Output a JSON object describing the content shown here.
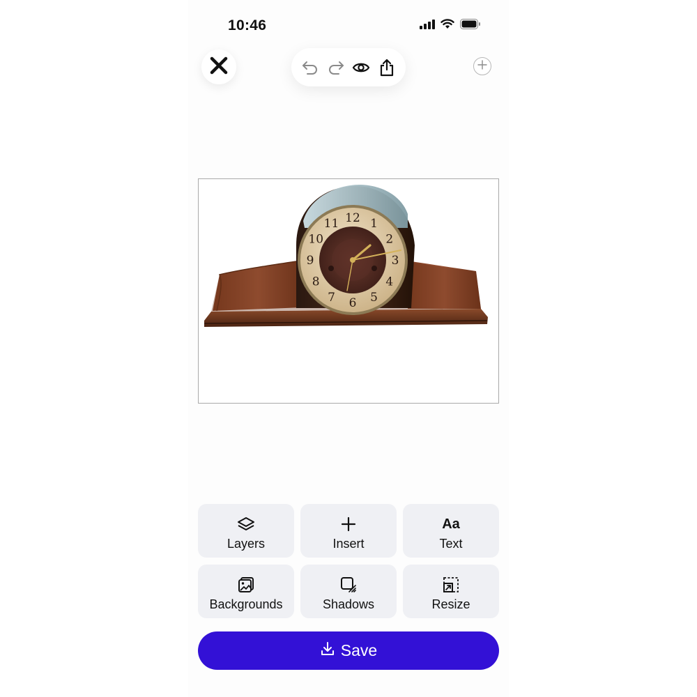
{
  "status_bar": {
    "time": "10:46",
    "icons": [
      "cellular-signal-icon",
      "wifi-icon",
      "battery-icon"
    ]
  },
  "toolbar": {
    "close_icon": "close-icon",
    "actions": [
      "undo-icon",
      "redo-icon",
      "preview-eye-icon",
      "share-icon"
    ],
    "add_page_icon": "plus-icon"
  },
  "canvas": {
    "image_subject": "tambour mantel clock",
    "clock_numerals": [
      "12",
      "1",
      "2",
      "3",
      "4",
      "5",
      "6",
      "7",
      "8",
      "9",
      "10",
      "11"
    ]
  },
  "tools": [
    {
      "label": "Layers",
      "icon": "layers-icon"
    },
    {
      "label": "Insert",
      "icon": "plus-icon"
    },
    {
      "label": "Text",
      "icon": "text-aa-icon",
      "glyph": "Aa"
    },
    {
      "label": "Backgrounds",
      "icon": "backgrounds-icon"
    },
    {
      "label": "Shadows",
      "icon": "shadows-icon"
    },
    {
      "label": "Resize",
      "icon": "resize-icon"
    }
  ],
  "save_button": {
    "label": "Save",
    "icon": "download-icon"
  },
  "colors": {
    "accent": "#3311d6",
    "tool_card_bg": "#eff0f4",
    "text": "#111111"
  }
}
